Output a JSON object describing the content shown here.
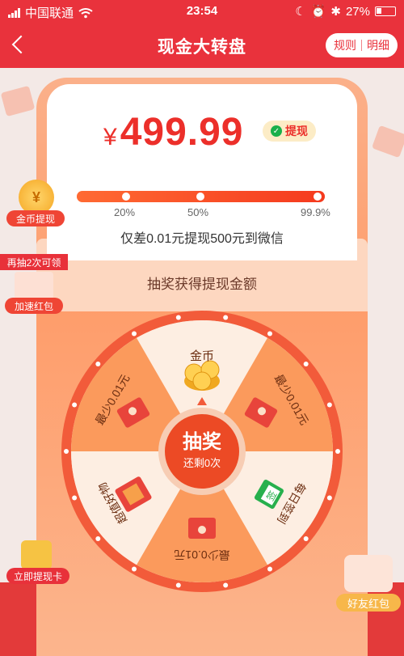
{
  "status": {
    "carrier": "中国联通",
    "time": "23:54",
    "battery": "27%"
  },
  "header": {
    "title": "现金大转盘",
    "rules": "规则",
    "detail": "明细"
  },
  "balance": {
    "currency": "¥",
    "amount": "499.99",
    "withdraw": "提现"
  },
  "progress": {
    "ticks": [
      "20%",
      "50%",
      "99.9%"
    ],
    "fill": 0.999,
    "remaining": "仅差0.01元提现500元到微信"
  },
  "lottery": {
    "title": "抽奖获得提现金额",
    "button": "抽奖",
    "remaining_spins": "还剩0次"
  },
  "wheel": {
    "segments": [
      "金币",
      "最少0.01元",
      "每日签到",
      "最少0.01元",
      "最少0.01元",
      "超值好物"
    ]
  },
  "side": {
    "coin_symbol": "¥",
    "coin_label": "金币提现",
    "extra_tag": "再抽2次可领",
    "extra_label": "加速红包",
    "card_label": "立即提现卡",
    "friend_label": "好友红包"
  },
  "colors": {
    "brand": "#e9323c",
    "orange": "#fe9d6b",
    "cream": "#fdeee2"
  }
}
